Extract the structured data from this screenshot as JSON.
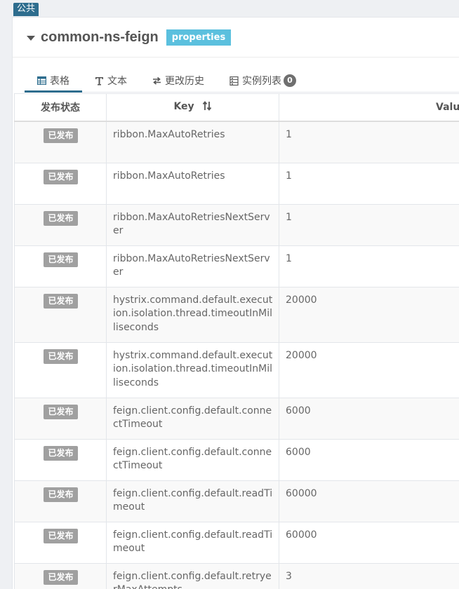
{
  "scope_tag": "公共",
  "namespace": {
    "name": "common-ns-feign",
    "format": "properties"
  },
  "tabs": {
    "table": "表格",
    "text": "文本",
    "history": "更改历史",
    "instances": "实例列表",
    "instances_count": "0"
  },
  "table": {
    "headers": {
      "status": "发布状态",
      "key": "Key",
      "value": "Value"
    },
    "rows": [
      {
        "status": "已发布",
        "key": "ribbon.MaxAutoRetries",
        "value": "1"
      },
      {
        "status": "已发布",
        "key": "ribbon.MaxAutoRetries",
        "value": "1"
      },
      {
        "status": "已发布",
        "key": "ribbon.MaxAutoRetriesNextServer",
        "value": "1"
      },
      {
        "status": "已发布",
        "key": "ribbon.MaxAutoRetriesNextServer",
        "value": "1"
      },
      {
        "status": "已发布",
        "key": "hystrix.command.default.execution.isolation.thread.timeoutInMilliseconds",
        "value": "20000"
      },
      {
        "status": "已发布",
        "key": "hystrix.command.default.execution.isolation.thread.timeoutInMilliseconds",
        "value": "20000"
      },
      {
        "status": "已发布",
        "key": "feign.client.config.default.connectTimeout",
        "value": "6000"
      },
      {
        "status": "已发布",
        "key": "feign.client.config.default.connectTimeout",
        "value": "6000"
      },
      {
        "status": "已发布",
        "key": "feign.client.config.default.readTimeout",
        "value": "60000"
      },
      {
        "status": "已发布",
        "key": "feign.client.config.default.readTimeout",
        "value": "60000"
      },
      {
        "status": "已发布",
        "key": "feign.client.config.default.retryerMaxAttempts",
        "value": "3"
      }
    ]
  }
}
